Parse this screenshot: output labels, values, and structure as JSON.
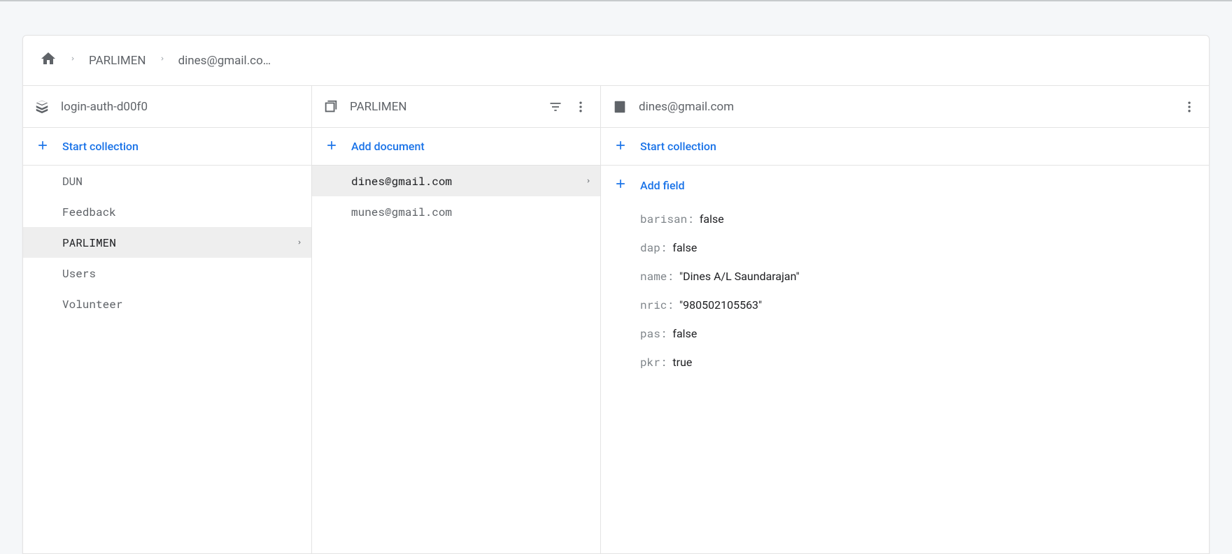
{
  "breadcrumb": {
    "items": [
      "PARLIMEN",
      "dines@gmail.co…"
    ]
  },
  "col1": {
    "headerTitle": "login-auth-d00f0",
    "actionLabel": "Start collection",
    "items": [
      {
        "label": "DUN",
        "selected": false
      },
      {
        "label": "Feedback",
        "selected": false
      },
      {
        "label": "PARLIMEN",
        "selected": true
      },
      {
        "label": "Users",
        "selected": false
      },
      {
        "label": "Volunteer",
        "selected": false
      }
    ]
  },
  "col2": {
    "headerTitle": "PARLIMEN",
    "actionLabel": "Add document",
    "items": [
      {
        "label": "dines@gmail.com",
        "selected": true
      },
      {
        "label": "munes@gmail.com",
        "selected": false
      }
    ]
  },
  "col3": {
    "headerTitle": "dines@gmail.com",
    "actionLabel": "Start collection",
    "addFieldLabel": "Add field",
    "fields": [
      {
        "key": "barisan",
        "value": "false",
        "type": "bool"
      },
      {
        "key": "dap",
        "value": "false",
        "type": "bool"
      },
      {
        "key": "name",
        "value": "\"Dines A/L Saundarajan\"",
        "type": "string"
      },
      {
        "key": "nric",
        "value": "\"980502105563\"",
        "type": "string"
      },
      {
        "key": "pas",
        "value": "false",
        "type": "bool"
      },
      {
        "key": "pkr",
        "value": "true",
        "type": "bool"
      }
    ]
  }
}
